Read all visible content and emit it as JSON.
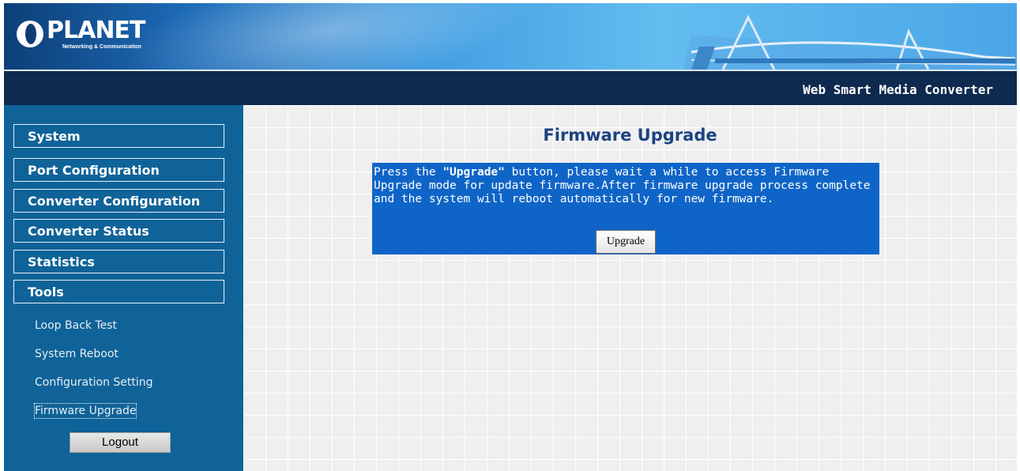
{
  "brand": {
    "logo_text": "PLANET",
    "logo_subtitle": "Networking & Communication"
  },
  "header": {
    "product_name": "Web Smart Media Converter"
  },
  "sidebar": {
    "menu": [
      {
        "label": "System"
      },
      {
        "label": "Port Configuration"
      },
      {
        "label": "Converter Configuration"
      },
      {
        "label": "Converter Status"
      },
      {
        "label": "Statistics"
      },
      {
        "label": "Tools"
      }
    ],
    "tools_items": [
      {
        "label": "Loop Back Test"
      },
      {
        "label": "System Reboot"
      },
      {
        "label": "Configuration Setting"
      },
      {
        "label": "Firmware Upgrade",
        "active": true
      }
    ],
    "logout_label": "Logout"
  },
  "main": {
    "title": "Firmware Upgrade",
    "message_prefix": "Press the ",
    "message_emphasis": "\"Upgrade\"",
    "message_rest": " button, please wait a while to access Firmware Upgrade mode for update firmware.After firmware upgrade process complete and the system will reboot automatically for new firmware.",
    "upgrade_button": "Upgrade"
  },
  "colors": {
    "sidebar_bg": "#0f6398",
    "titlebar_bg": "#0e2a4e",
    "panel_bg": "#0f65c7",
    "title_color": "#1b4381"
  }
}
